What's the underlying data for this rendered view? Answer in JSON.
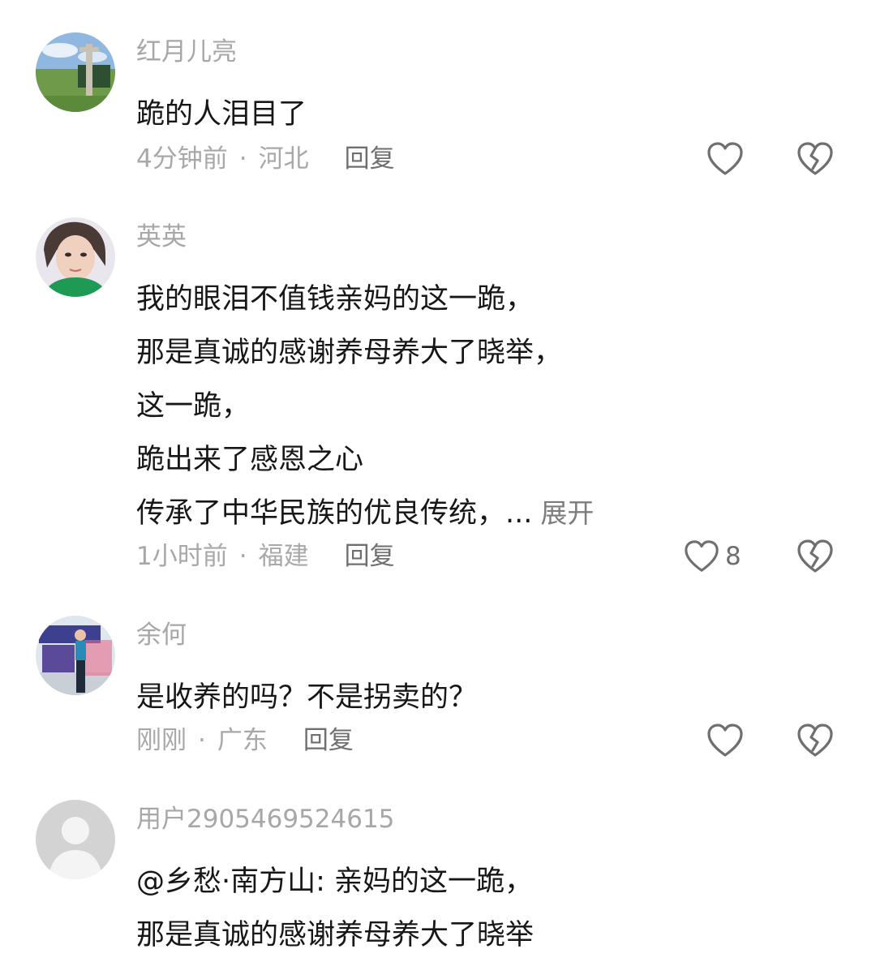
{
  "comments": [
    {
      "username": "红月儿亮",
      "lines": [
        "跪的人泪目了"
      ],
      "expand_label": "",
      "time": "4分钟前",
      "location": "河北",
      "reply_label": "回复",
      "like_count": ""
    },
    {
      "username": "英英",
      "lines": [
        "我的眼泪不值钱亲妈的这一跪，",
        "那是真诚的感谢养母养大了晓举，",
        "这一跪，",
        "跪出来了感恩之心",
        "传承了中华民族的优良传统，..."
      ],
      "expand_label": "展开",
      "time": "1小时前",
      "location": "福建",
      "reply_label": "回复",
      "like_count": "8"
    },
    {
      "username": "余何",
      "lines": [
        "是收养的吗？不是拐卖的？"
      ],
      "expand_label": "",
      "time": "刚刚",
      "location": "广东",
      "reply_label": "回复",
      "like_count": ""
    },
    {
      "username": "用户2905469524615",
      "lines": [
        "@乡愁·南方山: 亲妈的这一跪，",
        "那是真诚的感谢养母养大了晓举"
      ],
      "expand_label": "",
      "time": "",
      "location": "",
      "reply_label": "",
      "like_count": ""
    }
  ],
  "icons": {
    "like": "heart-outline-icon",
    "dislike": "broken-heart-icon"
  },
  "colors": {
    "text": "#171717",
    "secondary": "#a8a8a8",
    "icon": "#6f6f6f"
  }
}
